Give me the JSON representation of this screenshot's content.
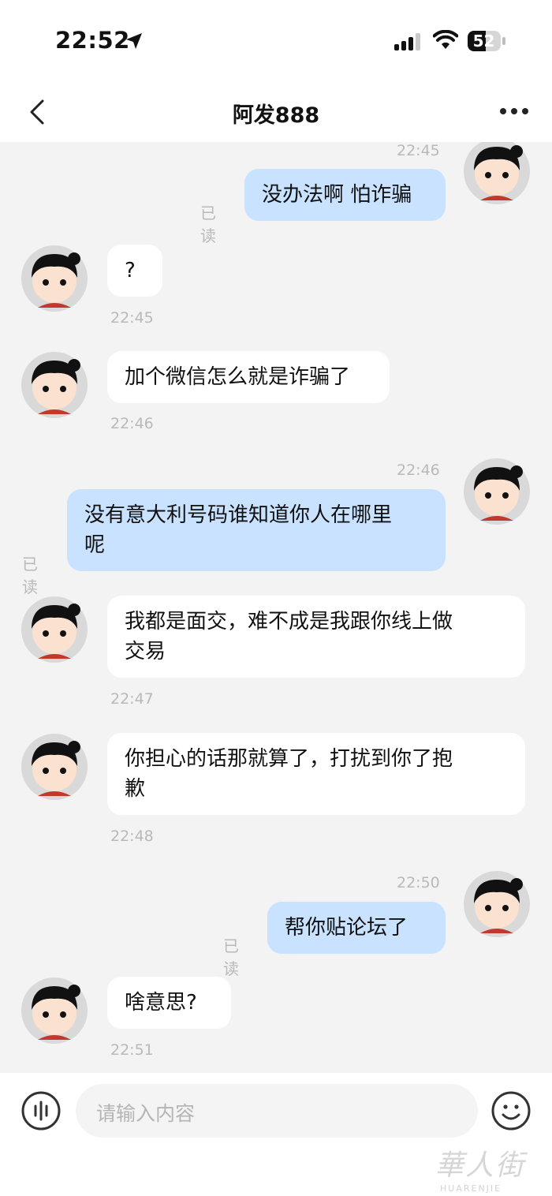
{
  "status_bar": {
    "time": "22:52",
    "battery": "52"
  },
  "header": {
    "title": "阿发888"
  },
  "messages": [
    {
      "side": "out",
      "time": "22:45",
      "text": "没办法啊 怕诈骗",
      "status": "已读"
    },
    {
      "side": "in",
      "time": "22:45",
      "text": "?"
    },
    {
      "side": "in",
      "time": "22:46",
      "text": "加个微信怎么就是诈骗了"
    },
    {
      "side": "out",
      "time": "22:46",
      "text_lines": [
        "没有意大利号码谁知道你人在哪里",
        "呢"
      ],
      "status": "已读"
    },
    {
      "side": "in",
      "time": "22:47",
      "text_lines": [
        "我都是面交，难不成是我跟你线上做",
        "交易"
      ]
    },
    {
      "side": "in",
      "time": "22:48",
      "text_lines": [
        "你担心的话那就算了，打扰到你了抱",
        "歉"
      ]
    },
    {
      "side": "out",
      "time": "22:50",
      "text": "帮你贴论坛了",
      "status": "已读"
    },
    {
      "side": "in",
      "time": "22:51",
      "text": "啥意思?"
    }
  ],
  "input": {
    "placeholder": "请输入内容"
  },
  "watermark": {
    "text": "華人街",
    "subtext": "HUARENJIE"
  }
}
